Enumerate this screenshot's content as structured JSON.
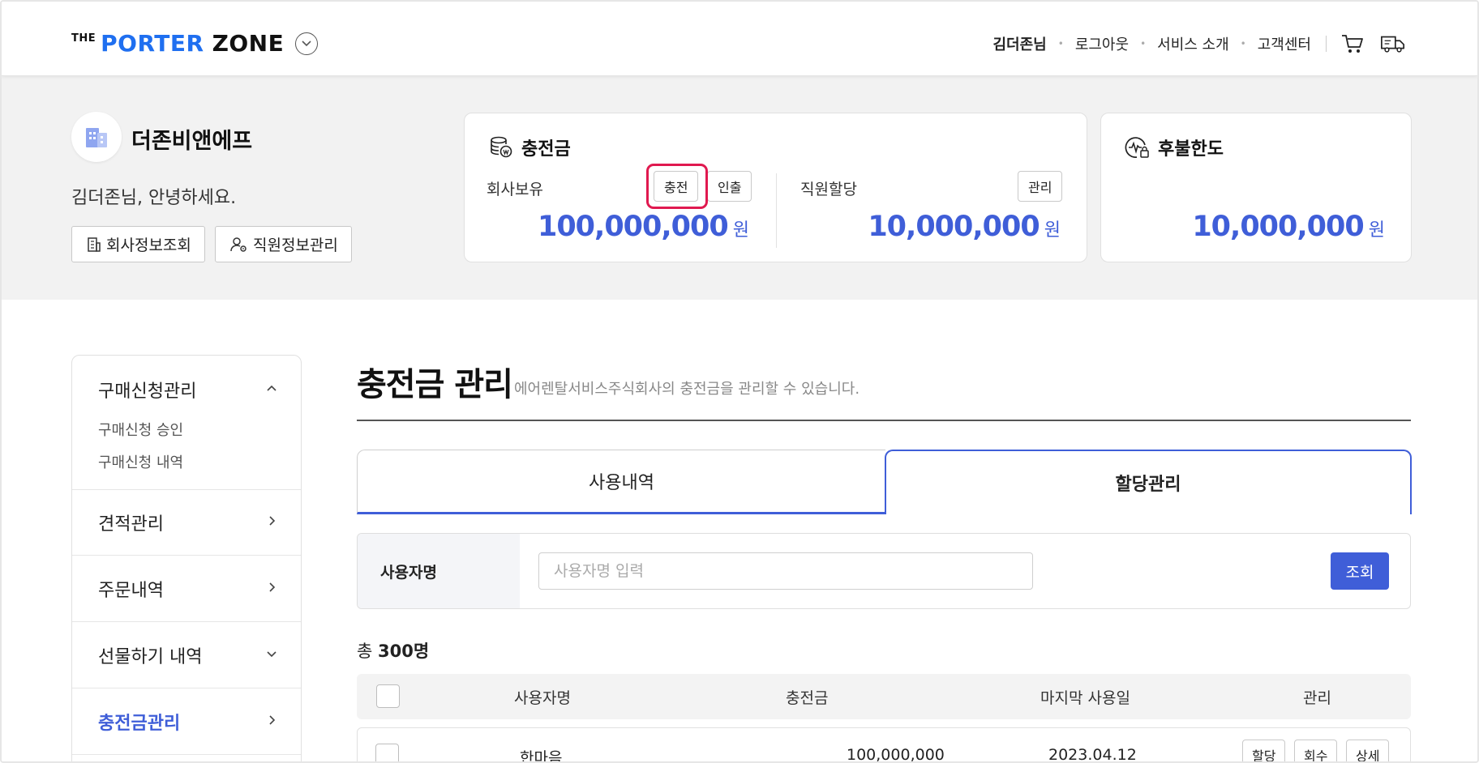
{
  "header": {
    "logo": {
      "the": "THE",
      "porter": "PORTER",
      "zone": "ZONE"
    },
    "nav": {
      "user": "김더존님",
      "logout": "로그아웃",
      "service": "서비스 소개",
      "support": "고객센터"
    },
    "icons": [
      "chevron-down-icon",
      "cart-icon",
      "delivery-truck-icon"
    ]
  },
  "company": {
    "name": "더존비앤에프",
    "greeting": "김더존님, 안녕하세요.",
    "company_info_button": "회사정보조회",
    "employee_info_button": "직원정보관리"
  },
  "charge_card": {
    "title": "충전금",
    "company_label": "회사보유",
    "charge_button": "충전",
    "withdraw_button": "인출",
    "company_amount": "100,000,000",
    "employee_label": "직원할당",
    "manage_button": "관리",
    "employee_amount": "10,000,000",
    "currency": "원"
  },
  "postpay_card": {
    "title": "후불한도",
    "amount": "10,000,000",
    "currency": "원"
  },
  "sidebar": {
    "groups": [
      {
        "label": "구매신청관리",
        "expanded": true,
        "subitems": [
          "구매신청 승인",
          "구매신청 내역"
        ]
      },
      {
        "label": "견적관리"
      },
      {
        "label": "주문내역"
      },
      {
        "label": "선물하기 내역"
      },
      {
        "label": "충전금관리",
        "active": true
      }
    ]
  },
  "main": {
    "title": "충전금 관리",
    "description": "에어렌탈서비스주식회사의 충전금을 관리할 수 있습니다.",
    "tabs": [
      {
        "label": "사용내역",
        "active": false
      },
      {
        "label": "할당관리",
        "active": true
      }
    ],
    "search": {
      "label": "사용자명",
      "placeholder": "사용자명 입력",
      "button": "조회"
    },
    "total_prefix": "총",
    "total_count": "300명",
    "table": {
      "headers": [
        "사용자명",
        "충전금",
        "마지막 사용일",
        "관리"
      ],
      "rows": [
        {
          "name": "한마음",
          "amount": "100,000,000",
          "last_used": "2023.04.12",
          "actions": [
            "할당",
            "회수",
            "상세"
          ]
        }
      ]
    }
  },
  "colors": {
    "accent": "#3f5ed8",
    "logo_blue": "#1f6ff0",
    "highlight": "#e0194f",
    "band_bg": "#f2f2f2"
  }
}
